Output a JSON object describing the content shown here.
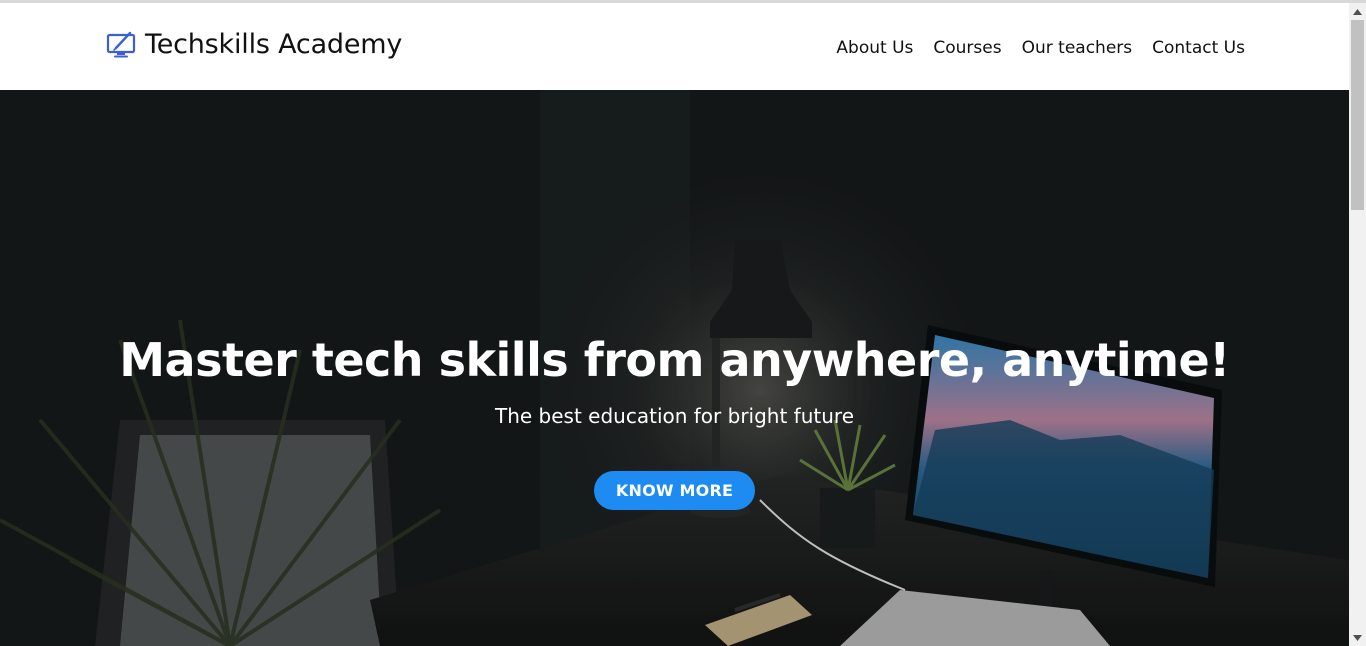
{
  "brand": {
    "name": "Techskills Academy",
    "icon": "monitor-pen-icon",
    "icon_color": "#3d5fd6"
  },
  "nav": {
    "items": [
      {
        "label": "About Us"
      },
      {
        "label": "Courses"
      },
      {
        "label": "Our teachers"
      },
      {
        "label": "Contact Us"
      }
    ]
  },
  "hero": {
    "title": "Master tech skills from anywhere, anytime!",
    "subtitle": "The best education for bright future",
    "cta_label": "KNOW MORE",
    "cta_color": "#1e8bf2",
    "background": "dark desk photo with desk lamp, monitor showing mountains, laptop, notebook and plants"
  },
  "colors": {
    "nav_background": "#ffffff",
    "text": "#111111",
    "hero_overlay": "#171b1c"
  }
}
